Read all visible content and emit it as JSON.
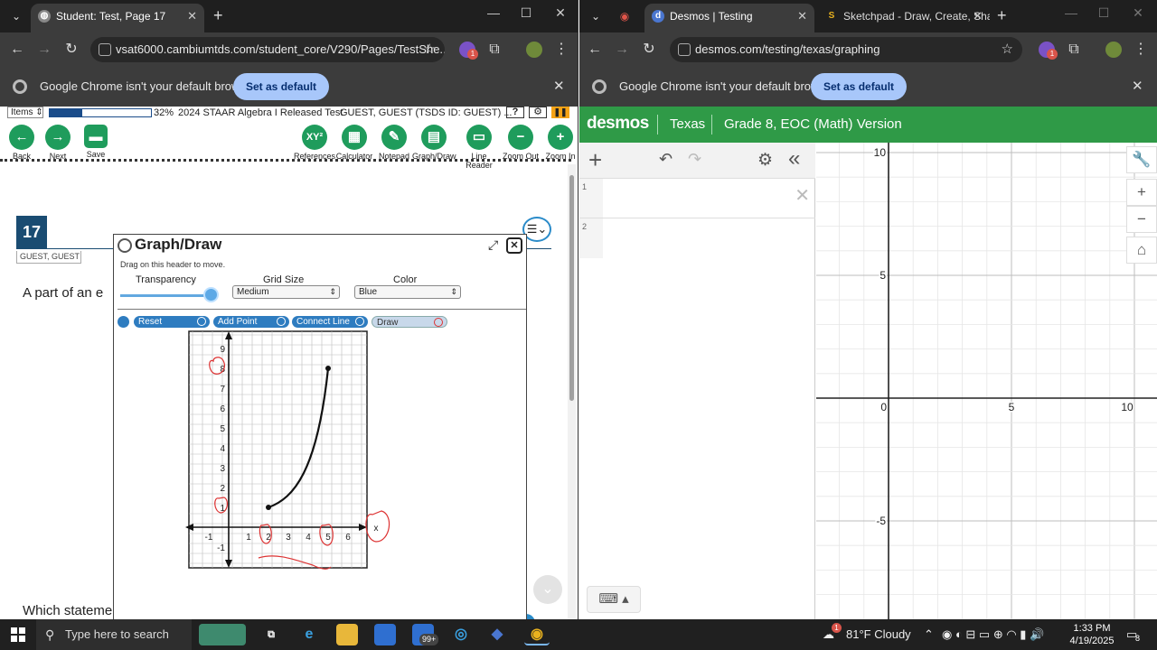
{
  "left_window": {
    "tab_title": "Student: Test, Page 17",
    "url": "vsat6000.cambiumtds.com/student_core/V290/Pages/TestShe...",
    "infobar_text": "Google Chrome isn't your default browser",
    "infobar_button": "Set as default",
    "ext_badge": "1"
  },
  "right_window": {
    "tab1_title": "Desmos | Testing",
    "tab2_title": "Sketchpad - Draw, Create, Sha",
    "url": "desmos.com/testing/texas/graphing",
    "infobar_text": "Google Chrome isn't your default browser",
    "infobar_button": "Set as default",
    "ext_badge": "1"
  },
  "test": {
    "items_select": "Items",
    "progress_percent": 32,
    "progress_label": "32%",
    "test_title": "2024 STAAR Algebra I Released Test",
    "student": "GUEST, GUEST (TSDS ID: GUEST) ...",
    "help": "?",
    "tools": [
      {
        "key": "back",
        "label": "Back",
        "glyph": "←"
      },
      {
        "key": "next",
        "label": "Next",
        "glyph": "→"
      },
      {
        "key": "save",
        "label": "Save",
        "glyph": "▬"
      },
      {
        "key": "references",
        "label": "References",
        "glyph": "XY²"
      },
      {
        "key": "calculator",
        "label": "Calculator",
        "glyph": "▦"
      },
      {
        "key": "notepad",
        "label": "Notepad",
        "glyph": "✎"
      },
      {
        "key": "graphdraw",
        "label": "Graph/Draw",
        "glyph": "▤"
      },
      {
        "key": "linereader",
        "label": "Line Reader",
        "glyph": "▭"
      },
      {
        "key": "zoomout",
        "label": "Zoom Out",
        "glyph": "−"
      },
      {
        "key": "zoomin",
        "label": "Zoom In",
        "glyph": "+"
      }
    ],
    "question_number": "17",
    "guest_name": "GUEST, GUEST",
    "question_text_start": "A part of an e",
    "question_text_bottom": "Which statements are true about the domain and range of the part of the"
  },
  "graphdraw": {
    "title": "Graph/Draw",
    "hint": "Drag on this header to move.",
    "transparency_label": "Transparency",
    "transparency_value": 0.92,
    "grid_size_label": "Grid Size",
    "grid_size_value": "Medium",
    "color_label": "Color",
    "color_value": "Blue",
    "buttons": {
      "reset": "Reset",
      "add_point": "Add Point",
      "connect_line": "Connect Line",
      "draw": "Draw"
    },
    "y_ticks": [
      "9",
      "8",
      "7",
      "6",
      "5",
      "4",
      "3",
      "2",
      "1",
      "-1"
    ],
    "x_ticks": [
      "-1",
      "1",
      "2",
      "3",
      "4",
      "5",
      "6"
    ],
    "x_axis_label": "x",
    "curve_points": [
      [
        2,
        1
      ],
      [
        5,
        8
      ]
    ]
  },
  "desmos": {
    "logo": "desmos",
    "region": "Texas",
    "version": "Grade 8, EOC (Math) Version",
    "expression_rows": [
      "1",
      "2"
    ],
    "x_ticks": [
      "0",
      "5",
      "10"
    ],
    "y_ticks": [
      "10",
      "5",
      "-5"
    ]
  },
  "taskbar": {
    "search_placeholder": "Type here to search",
    "mail_badge": "99+",
    "weather": "81°F Cloudy",
    "weather_badge": "1",
    "time": "1:33 PM",
    "date": "4/19/2025",
    "notif_count": "8"
  },
  "colors": {
    "chrome_dark": "#3c3c3c",
    "desmos_green": "#2f9a47",
    "tool_green": "#1f9c5c",
    "question_blue": "#1a4c72",
    "annotation_red": "#d33"
  }
}
